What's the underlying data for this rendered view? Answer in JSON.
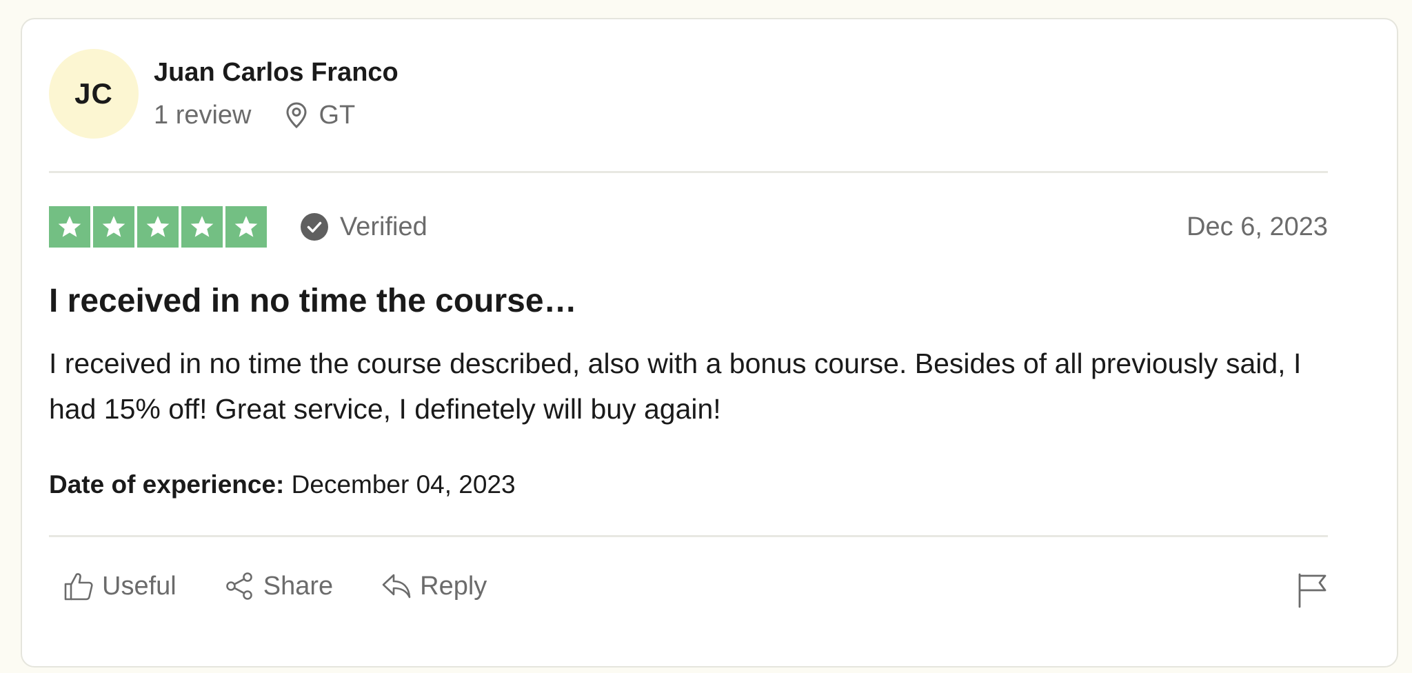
{
  "reviewer": {
    "initials": "JC",
    "name": "Juan Carlos Franco",
    "review_count": "1 review",
    "location": "GT",
    "avatar_color": "#fcf6d2"
  },
  "review": {
    "rating": 5,
    "max_rating": 5,
    "star_color": "#73bf83",
    "verified_label": "Verified",
    "date": "Dec 6, 2023",
    "title": "I received in no time the course…",
    "body": "I received in no time the course described, also with a bonus course. Besides of all previously said, I had 15% off! Great service, I definetely will buy again!",
    "experience_label": "Date of experience:",
    "experience_date": "December 04, 2023"
  },
  "actions": {
    "useful_label": "Useful",
    "share_label": "Share",
    "reply_label": "Reply"
  },
  "icons": {
    "location": "location-pin-icon",
    "verified": "check-circle-icon",
    "useful": "thumbs-up-icon",
    "share": "share-icon",
    "reply": "reply-icon",
    "flag": "flag-icon"
  }
}
